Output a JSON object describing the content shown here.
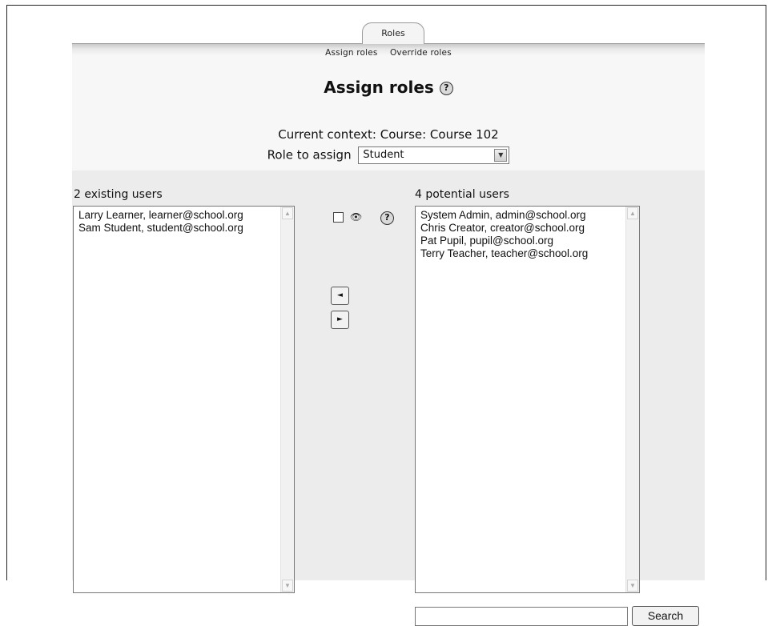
{
  "tabs": {
    "active": "Roles",
    "subtabs": [
      "Assign roles",
      "Override roles"
    ]
  },
  "page": {
    "title": "Assign roles",
    "help_glyph": "?",
    "context_label": "Current context: Course: Course 102",
    "role_label": "Role to assign",
    "role_selected": "Student"
  },
  "existing": {
    "label": "2 existing users",
    "users": [
      "Larry Learner, learner@school.org",
      "Sam Student, student@school.org"
    ]
  },
  "potential": {
    "label": "4 potential users",
    "users": [
      "System Admin, admin@school.org",
      "Chris Creator, creator@school.org",
      "Pat Pupil, pupil@school.org",
      "Terry Teacher, teacher@school.org"
    ]
  },
  "controls": {
    "add_glyph": "◄",
    "remove_glyph": "►",
    "eye_icon": "eye-icon"
  },
  "search": {
    "input_value": "",
    "button_label": "Search"
  }
}
